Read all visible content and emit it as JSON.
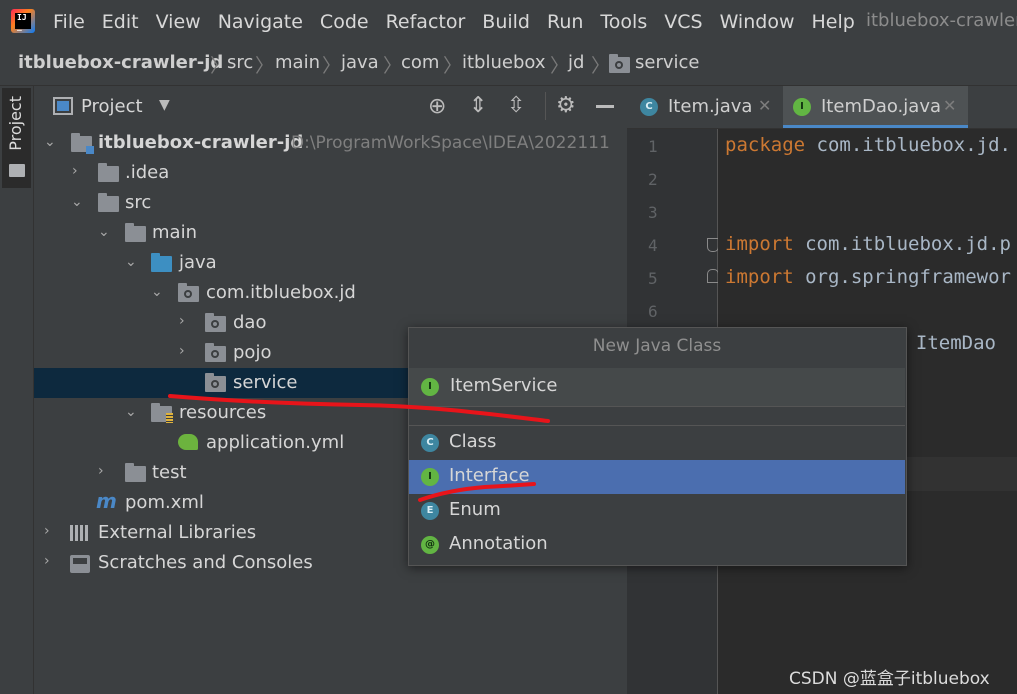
{
  "menubar": {
    "items": [
      "File",
      "Edit",
      "View",
      "Navigate",
      "Code",
      "Refactor",
      "Build",
      "Run",
      "Tools",
      "VCS",
      "Window",
      "Help"
    ],
    "window_title": "itbluebox-crawler"
  },
  "breadcrumb": {
    "items": [
      "itbluebox-crawler-jd",
      "src",
      "main",
      "java",
      "com",
      "itbluebox",
      "jd",
      "service"
    ]
  },
  "left_stripe": {
    "project_label": "Project"
  },
  "project_panel": {
    "view_label": "Project",
    "tree": [
      {
        "label": "itbluebox-crawler-jd",
        "path": "D:\\ProgramWorkSpace\\IDEA\\2022111"
      },
      {
        "label": ".idea"
      },
      {
        "label": "src"
      },
      {
        "label": "main"
      },
      {
        "label": "java"
      },
      {
        "label": "com.itbluebox.jd"
      },
      {
        "label": "dao"
      },
      {
        "label": "pojo"
      },
      {
        "label": "service"
      },
      {
        "label": "resources"
      },
      {
        "label": "application.yml"
      },
      {
        "label": "test"
      },
      {
        "label": "pom.xml"
      },
      {
        "label": "External Libraries"
      },
      {
        "label": "Scratches and Consoles"
      }
    ]
  },
  "editor": {
    "tabs": [
      {
        "label": "Item.java",
        "badge": "C"
      },
      {
        "label": "ItemDao.java",
        "badge": "I"
      }
    ],
    "line_numbers": [
      "1",
      "2",
      "3",
      "4",
      "5",
      "6"
    ],
    "code": {
      "line1_kw": "package",
      "line1_rest": " com.itbluebox.jd.",
      "line4_kw": "import",
      "line4_rest": " com.itbluebox.jd.p",
      "line5_kw": "import",
      "line5_rest": " org.springframewor",
      "line7_kw": "e",
      "line7_rest": " ItemDao"
    }
  },
  "popup": {
    "title": "New Java Class",
    "name_value": "ItemService",
    "name_badge": "I",
    "options": [
      {
        "label": "Class",
        "badge": "C"
      },
      {
        "label": "Interface",
        "badge": "I"
      },
      {
        "label": "Enum",
        "badge": "E"
      },
      {
        "label": "Annotation",
        "badge": "@"
      }
    ],
    "selected_option": "Interface"
  },
  "colors": {
    "selection": "#4b6eaf",
    "tree_selection": "#0d293e",
    "annotation_red": "#e8141a",
    "keyword": "#cc7832"
  },
  "watermark": "CSDN @蓝盒子itbluebox"
}
